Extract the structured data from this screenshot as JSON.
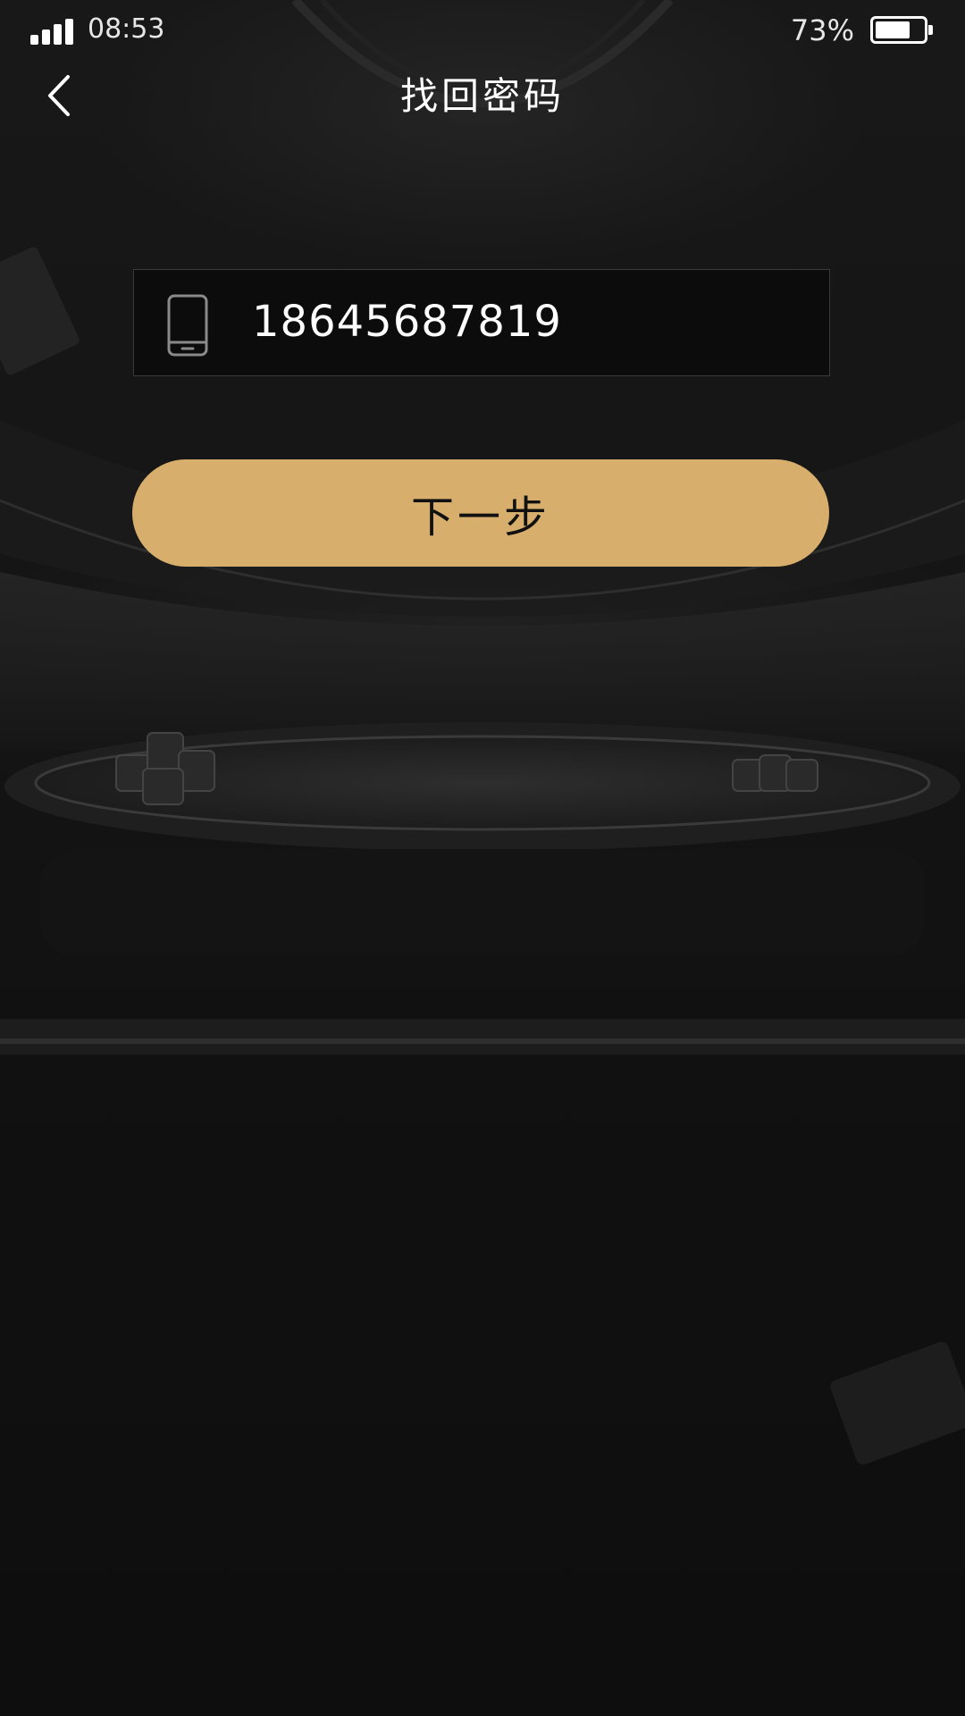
{
  "status_bar": {
    "time": "08:53",
    "battery_percent_text": "73%",
    "battery_level": 0.73,
    "signal_bars": 4
  },
  "header": {
    "title": "找回密码",
    "back_icon": "chevron-left-icon"
  },
  "form": {
    "phone_icon": "mobile-phone-icon",
    "phone_value": "18645687819",
    "next_label": "下一步"
  },
  "colors": {
    "accent": "#d8ae6c",
    "background": "#121212",
    "field_border": "#3a3a3a"
  }
}
